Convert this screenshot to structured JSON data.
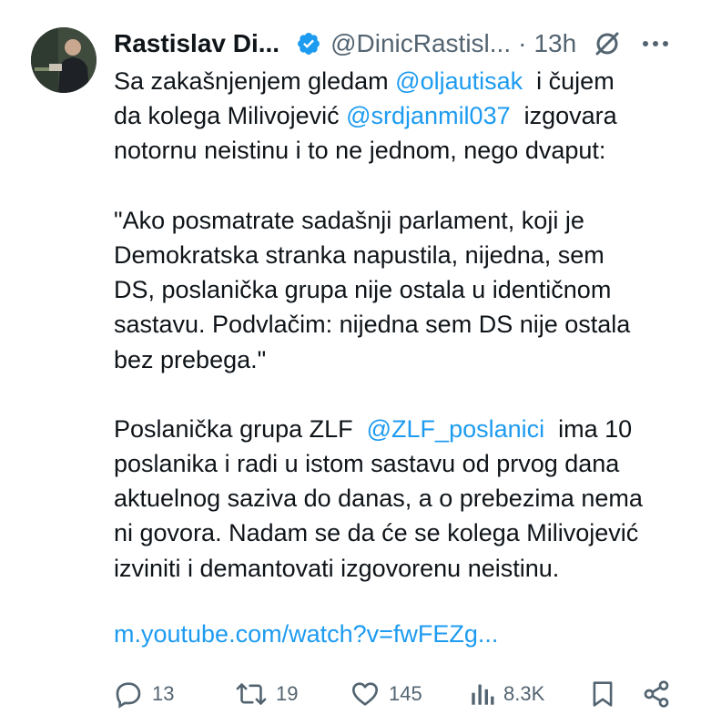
{
  "author": {
    "name": "Rastislav Di...",
    "handle": "@DinicRastisl...",
    "separator": "·",
    "time": "13h"
  },
  "body": {
    "lines": [
      [
        {
          "t": "Sa zakašnjenjem gledam "
        },
        {
          "t": "@oljautisak",
          "m": true
        },
        {
          "t": "  i čujem"
        }
      ],
      [
        {
          "t": "da kolega Milivojević "
        },
        {
          "t": "@srdjanmil037",
          "m": true
        },
        {
          "t": "  izgovara"
        }
      ],
      [
        {
          "t": "notornu neistinu i to ne jednom, nego dvaput:"
        }
      ],
      [],
      [
        {
          "t": "\"Ako posmatrate sadašnji parlament, koji je"
        }
      ],
      [
        {
          "t": "Demokratska stranka napustila, nijedna, sem"
        }
      ],
      [
        {
          "t": "DS, poslanička grupa nije ostala u identičnom"
        }
      ],
      [
        {
          "t": "sastavu. Podvlačim: nijedna sem DS nije ostala"
        }
      ],
      [
        {
          "t": "bez prebega.\""
        }
      ],
      [],
      [
        {
          "t": "Poslanička grupa ZLF  "
        },
        {
          "t": "@ZLF_poslanici",
          "m": true
        },
        {
          "t": "  ima 10"
        }
      ],
      [
        {
          "t": "poslanika i radi u istom sastavu od prvog dana"
        }
      ],
      [
        {
          "t": "aktuelnog saziva do danas, a o prebezima nema"
        }
      ],
      [
        {
          "t": "ni govora. Nadam se da će se kolega Milivojević"
        }
      ],
      [
        {
          "t": "izviniti i demantovati izgovorenu neistinu."
        }
      ]
    ],
    "link": "m.youtube.com/watch?v=fwFEZg..."
  },
  "actions": {
    "replies": "13",
    "reposts": "19",
    "likes": "145",
    "views": "8.3K"
  },
  "icons": [
    "verified-badge-icon",
    "grok-icon",
    "more-options-icon",
    "reply-icon",
    "repost-icon",
    "like-icon",
    "views-icon",
    "bookmark-icon",
    "share-icon"
  ],
  "colors": {
    "text": "#0f1419",
    "secondary": "#536471",
    "accent": "#1d9bf0"
  }
}
